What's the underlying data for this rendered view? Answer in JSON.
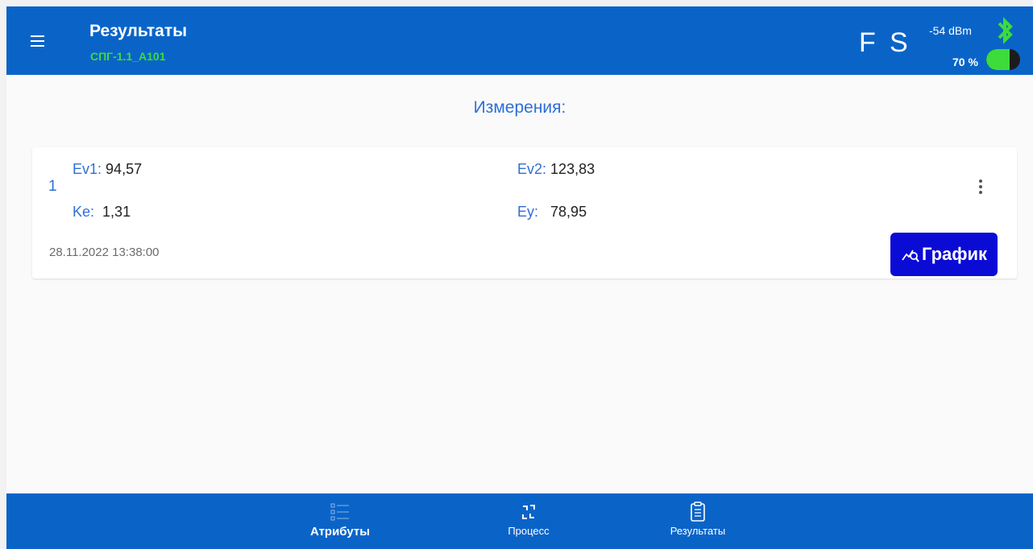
{
  "header": {
    "title": "Результаты",
    "subtitle": "СПГ-1.1_А101",
    "status_f": "F",
    "status_s": "S",
    "signal": "-54 dBm",
    "battery_label": "70 %",
    "battery_level": 0.7,
    "icons": {
      "menu": "menu-icon",
      "bluetooth": "bluetooth-icon",
      "battery": "battery-icon"
    }
  },
  "section_title": "Измерения:",
  "measurements": [
    {
      "index": "1",
      "ev1_label": "Ev1:",
      "ev1_value": "94,57",
      "ev2_label": "Ev2:",
      "ev2_value": "123,83",
      "ke_label": "Ke:",
      "ke_value": "1,31",
      "ey_label": "Ey:",
      "ey_value": "78,95",
      "timestamp": "28.11.2022 13:38:00",
      "graph_button": "График"
    }
  ],
  "bottom_nav": {
    "items": [
      {
        "label": "Атрибуты",
        "icon": "list-icon"
      },
      {
        "label": "Процесс",
        "icon": "refresh-icon"
      },
      {
        "label": "Результаты",
        "icon": "clipboard-icon"
      }
    ]
  },
  "colors": {
    "bar": "#0a64c8",
    "accent_blue": "#2e6fd4",
    "green": "#3ddc3a",
    "graph_button": "#0b0bd6"
  }
}
